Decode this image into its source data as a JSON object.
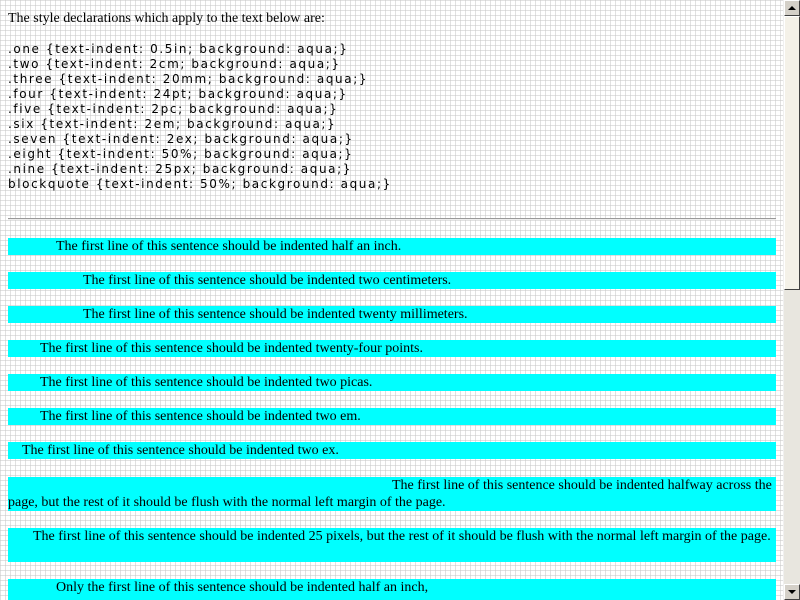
{
  "intro": "The style declarations which apply to the text below are:",
  "css_lines": [
    ".one {text-indent: 0.5in; background: aqua;}",
    ".two {text-indent: 2cm; background: aqua;}",
    ".three {text-indent: 20mm; background: aqua;}",
    ".four {text-indent: 24pt; background: aqua;}",
    ".five {text-indent: 2pc; background: aqua;}",
    ".six {text-indent: 2em; background: aqua;}",
    ".seven {text-indent: 2ex; background: aqua;}",
    ".eight {text-indent: 50%; background: aqua;}",
    ".nine {text-indent: 25px; background: aqua;}",
    "blockquote {text-indent: 50%; background: aqua;}"
  ],
  "paragraphs": [
    "The first line of this sentence should be indented half an inch.",
    "The first line of this sentence should be indented two centimeters.",
    "The first line of this sentence should be indented twenty millimeters.",
    "The first line of this sentence should be indented twenty-four points.",
    "The first line of this sentence should be indented two picas.",
    "The first line of this sentence should be indented two em.",
    "The first line of this sentence should be indented two ex.",
    "The first line of this sentence should be indented halfway across the page, but the rest of it should be flush with the normal left margin of the page.",
    "The first line of this sentence should be indented 25 pixels, but the rest of it should be flush with the normal left margin of the page.",
    "Only the first line of this sentence should be indented half an inch,"
  ],
  "colors": {
    "highlight": "#00ffff",
    "scrollbar_face": "#d4d0c8"
  },
  "scrollbar": {
    "scroll_fraction": 0.0
  }
}
